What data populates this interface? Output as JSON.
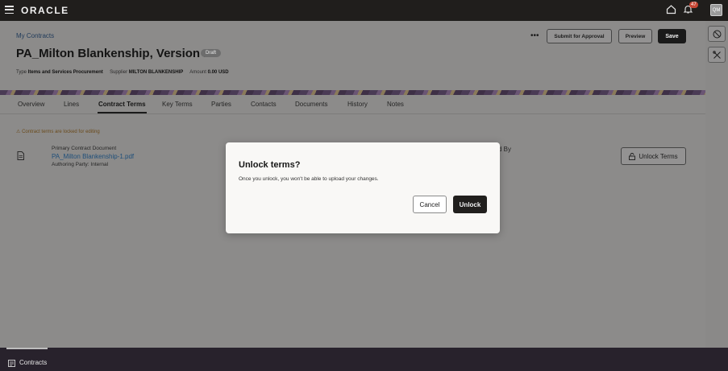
{
  "topbar": {
    "brand": "ORACLE",
    "notification_count": "47",
    "user_initials": "QM"
  },
  "header": {
    "breadcrumb": "My Contracts",
    "title": "PA_Milton Blankenship, Version 1",
    "status_badge": "Draft",
    "type_label": "Type",
    "type_value": "Items and Services Procurement",
    "supplier_label": "Supplier",
    "supplier_value": "MILTON BLANKENSHIP",
    "amount_label": "Amount",
    "amount_value": "0.00 USD",
    "more_actions": "•••",
    "submit_label": "Submit for Approval",
    "preview_label": "Preview",
    "save_label": "Save"
  },
  "tabs": [
    {
      "label": "Overview"
    },
    {
      "label": "Lines"
    },
    {
      "label": "Contract Terms"
    },
    {
      "label": "Key Terms"
    },
    {
      "label": "Parties"
    },
    {
      "label": "Contacts"
    },
    {
      "label": "Documents"
    },
    {
      "label": "History"
    },
    {
      "label": "Notes"
    }
  ],
  "active_tab": "Contract Terms",
  "content": {
    "locked_message": "Contract terms are locked for editing",
    "doc_label": "Primary Contract Document",
    "doc_link": "PA_Milton Blankenship-1.pdf",
    "authoring_party": "Authoring Party: Internal",
    "partial_text": "d By",
    "unlock_terms_label": "Unlock Terms"
  },
  "modal": {
    "title": "Unlock terms?",
    "body": "Once you unlock, you won't be able to upload your changes.",
    "cancel_label": "Cancel",
    "unlock_label": "Unlock"
  },
  "bottombar": {
    "label": "Contracts"
  },
  "colors": {
    "topbar": "#201e1c",
    "bottombar": "#28222c",
    "primary_button": "#1a1a1a",
    "link": "#1f4f7a"
  }
}
